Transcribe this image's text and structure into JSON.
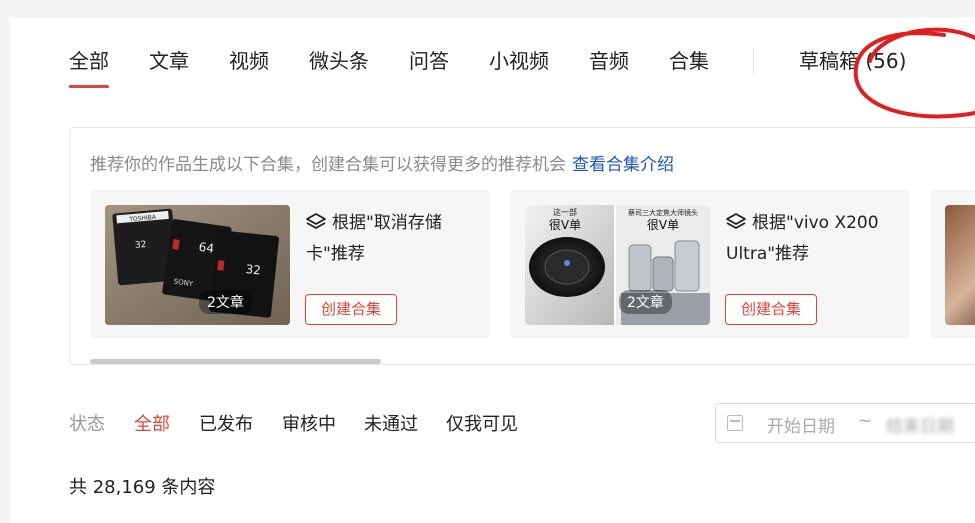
{
  "tabs": [
    {
      "label": "全部",
      "active": true
    },
    {
      "label": "文章"
    },
    {
      "label": "视频"
    },
    {
      "label": "微头条"
    },
    {
      "label": "问答"
    },
    {
      "label": "小视频"
    },
    {
      "label": "音频"
    },
    {
      "label": "合集"
    }
  ],
  "drafts_label": "草稿箱 (56)",
  "recommend": {
    "tip": "推荐你的作品生成以下合集，创建合集可以获得更多的推荐机会",
    "link": "查看合集介绍",
    "cards": [
      {
        "title": "根据\"取消存储卡\"推荐",
        "count": "2文章",
        "button": "创建合集",
        "image_text": [
          "TOSHIBA",
          "32",
          "64",
          "32",
          "SONY"
        ]
      },
      {
        "title": "根据\"vivo X200 Ultra\"推荐",
        "count": "2文章",
        "button": "创建合集",
        "image_text": [
          "这一部",
          "很V单",
          "蔡司三大定焦大师镜头",
          "很V单"
        ]
      }
    ]
  },
  "filters": {
    "label": "状态",
    "items": [
      {
        "label": "全部",
        "active": true
      },
      {
        "label": "已发布"
      },
      {
        "label": "审核中"
      },
      {
        "label": "未通过"
      },
      {
        "label": "仅我可见"
      }
    ]
  },
  "date_range": {
    "start_placeholder": "开始日期",
    "separator": "~",
    "end_placeholder": "结束日期"
  },
  "total": "共 28,169 条内容",
  "colors": {
    "accent": "#e1443b",
    "link": "#1a56b8",
    "annotation": "#e02020"
  }
}
